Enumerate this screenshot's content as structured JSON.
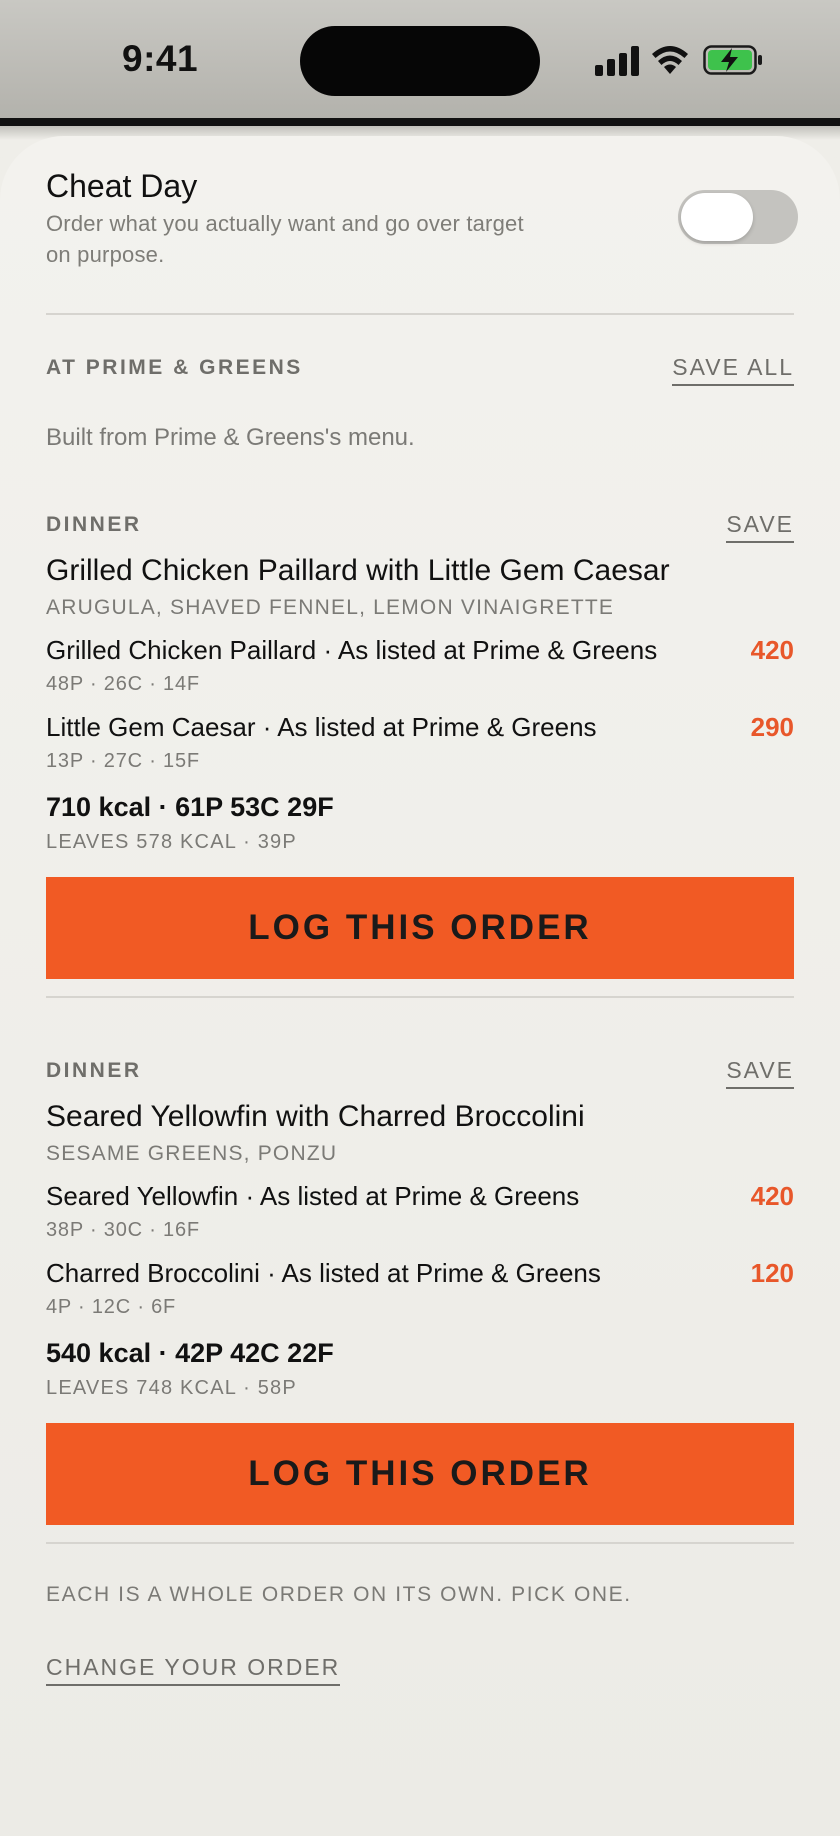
{
  "status": {
    "time": "9:41"
  },
  "cheat": {
    "title": "Cheat Day",
    "desc_line1": "Order what you actually want and go over target",
    "desc_line2": "on purpose.",
    "toggle_on": false
  },
  "restaurant": {
    "header": "AT PRIME & GREENS",
    "save_all": "SAVE ALL",
    "intro": "Built from Prime & Greens's menu."
  },
  "orders": [
    {
      "meal": "DINNER",
      "save": "SAVE",
      "title": "Grilled Chicken Paillard with Little Gem Caesar",
      "subtitle": "ARUGULA, SHAVED FENNEL, LEMON VINAIGRETTE",
      "items": [
        {
          "name": "Grilled Chicken Paillard · As listed at Prime & Greens",
          "macros": "48P · 26C · 14F",
          "kcal": "420"
        },
        {
          "name": "Little Gem Caesar · As listed at Prime & Greens",
          "macros": "13P · 27C · 15F",
          "kcal": "290"
        }
      ],
      "total": "710 kcal · 61P 53C 29F",
      "leaves": "LEAVES 578 KCAL · 39P",
      "button": "LOG THIS ORDER"
    },
    {
      "meal": "DINNER",
      "save": "SAVE",
      "title": "Seared Yellowfin with Charred Broccolini",
      "subtitle": "SESAME GREENS, PONZU",
      "items": [
        {
          "name": "Seared Yellowfin · As listed at Prime & Greens",
          "macros": "38P · 30C · 16F",
          "kcal": "420"
        },
        {
          "name": "Charred Broccolini · As listed at Prime & Greens",
          "macros": "4P · 12C · 6F",
          "kcal": "120"
        }
      ],
      "total": "540 kcal · 42P 42C 22F",
      "leaves": "LEAVES 748 KCAL · 58P",
      "button": "LOG THIS ORDER"
    }
  ],
  "footer": {
    "note": "EACH IS A WHOLE ORDER ON ITS OWN. PICK ONE.",
    "change": "CHANGE YOUR ORDER"
  },
  "colors": {
    "accent": "#f15a24",
    "kcal": "#e8572a",
    "background": "#ecebe6"
  },
  "icons": [
    "cellular-signal-icon",
    "wifi-icon",
    "battery-charging-icon"
  ]
}
